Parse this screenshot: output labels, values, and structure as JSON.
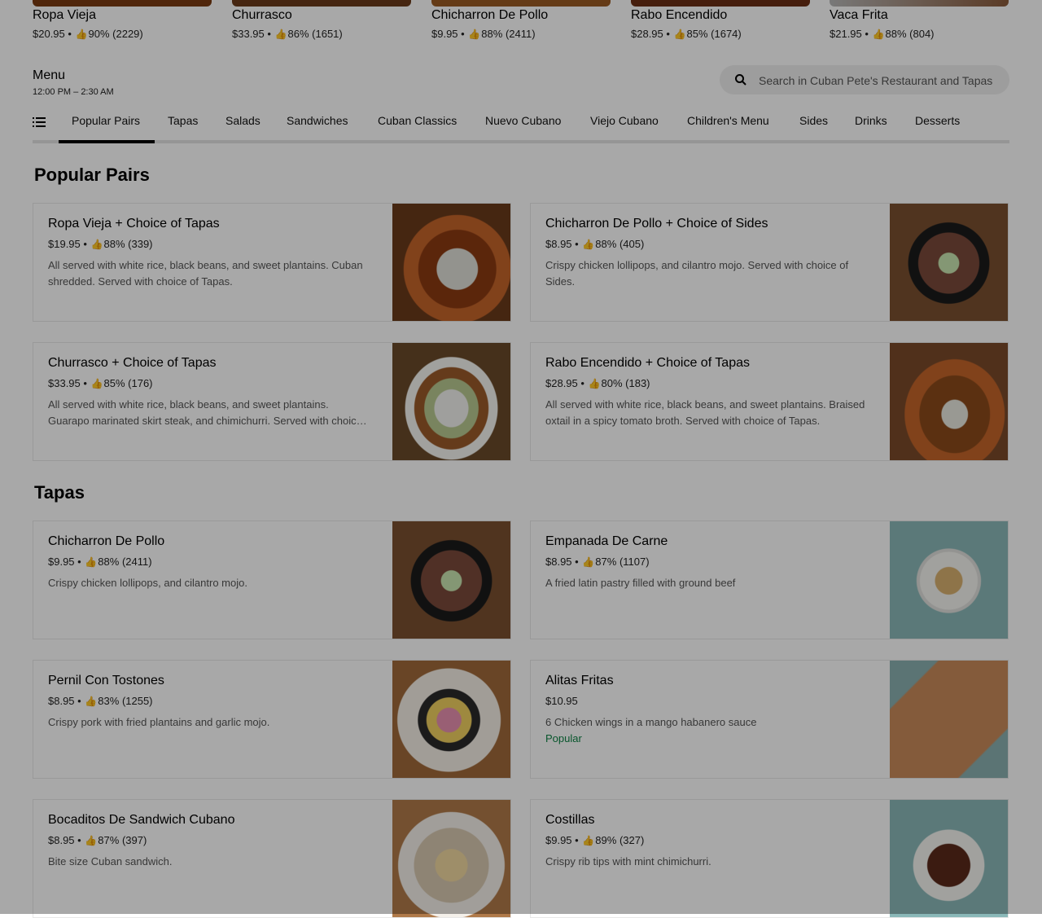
{
  "featured": [
    {
      "name": "Ropa Vieja",
      "price": "$20.95",
      "rating": "90%",
      "count": "(2229)"
    },
    {
      "name": "Churrasco",
      "price": "$33.95",
      "rating": "86%",
      "count": "(1651)"
    },
    {
      "name": "Chicharron De Pollo",
      "price": "$9.95",
      "rating": "88%",
      "count": "(2411)"
    },
    {
      "name": "Rabo Encendido",
      "price": "$28.95",
      "rating": "85%",
      "count": "(1674)"
    },
    {
      "name": "Vaca Frita",
      "price": "$21.95",
      "rating": "88%",
      "count": "(804)"
    }
  ],
  "menu": {
    "title": "Menu",
    "hours": "12:00 PM – 2:30 AM"
  },
  "search": {
    "placeholder": "Search in Cuban Pete's Restaurant and Tapas"
  },
  "tabs": [
    {
      "label": "Popular Pairs",
      "active": true
    },
    {
      "label": "Tapas"
    },
    {
      "label": "Salads"
    },
    {
      "label": "Sandwiches"
    },
    {
      "label": "Cuban Classics"
    },
    {
      "label": "Nuevo Cubano"
    },
    {
      "label": "Viejo Cubano"
    },
    {
      "label": "Children's Menu"
    },
    {
      "label": "Sides"
    },
    {
      "label": "Drinks"
    },
    {
      "label": "Desserts"
    }
  ],
  "sections": [
    {
      "title": "Popular Pairs",
      "items": [
        {
          "name": "Ropa Vieja + Choice of Tapas",
          "price": "$19.95",
          "rating": "88%",
          "count": "(339)",
          "desc": "All served with white rice, black beans, and sweet plantains. Cuban shredded. Served with choice of Tapas."
        },
        {
          "name": "Chicharron De Pollo + Choice of Sides",
          "price": "$8.95",
          "rating": "88%",
          "count": "(405)",
          "desc": "Crispy chicken lollipops, and cilantro mojo. Served with choice of Sides."
        },
        {
          "name": "Churrasco + Choice of Tapas",
          "price": "$33.95",
          "rating": "85%",
          "count": "(176)",
          "desc": "All served with white rice, black beans, and sweet plantains. Guarapo marinated skirt steak, and chimichurri. Served with choice of Tapas."
        },
        {
          "name": "Rabo Encendido + Choice of Tapas",
          "price": "$28.95",
          "rating": "80%",
          "count": "(183)",
          "desc": "All served with white rice, black beans, and sweet plantains. Braised oxtail in a spicy tomato broth. Served with choice of Tapas."
        }
      ]
    },
    {
      "title": "Tapas",
      "items": [
        {
          "name": "Chicharron De Pollo",
          "price": "$9.95",
          "rating": "88%",
          "count": "(2411)",
          "desc": "Crispy chicken lollipops, and cilantro mojo."
        },
        {
          "name": "Empanada De Carne",
          "price": "$8.95",
          "rating": "87%",
          "count": "(1107)",
          "desc": "A fried latin pastry filled with ground beef"
        },
        {
          "name": "Pernil Con Tostones",
          "price": "$8.95",
          "rating": "83%",
          "count": "(1255)",
          "desc": "Crispy pork with fried plantains and garlic mojo."
        },
        {
          "name": "Alitas Fritas",
          "price": "$10.95",
          "desc": "6 Chicken wings in a mango habanero sauce",
          "badge": "Popular"
        },
        {
          "name": "Bocaditos De Sandwich Cubano",
          "price": "$8.95",
          "rating": "87%",
          "count": "(397)",
          "desc": "Bite size Cuban sandwich."
        },
        {
          "name": "Costillas",
          "price": "$9.95",
          "rating": "89%",
          "count": "(327)",
          "desc": "Crispy rib tips with mint chimichurri."
        }
      ]
    }
  ],
  "colors": {
    "badge": "#0e8345",
    "overlay": "rgba(0,0,0,0.34)"
  }
}
